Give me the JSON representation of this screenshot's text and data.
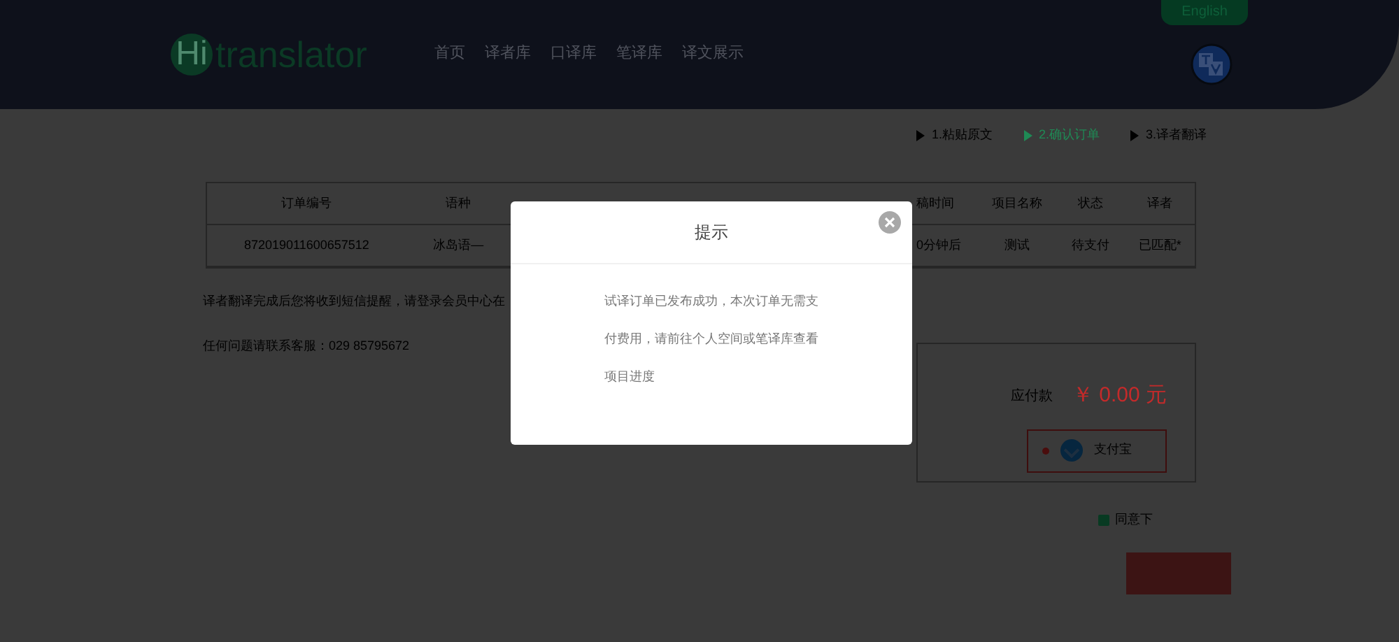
{
  "header": {
    "logo": {
      "mark": "Hi",
      "text": "translator"
    },
    "nav": [
      {
        "label": "首页"
      },
      {
        "label": "译者库"
      },
      {
        "label": "口译库"
      },
      {
        "label": "笔译库"
      },
      {
        "label": "译文展示"
      }
    ],
    "language_button": "English"
  },
  "steps": [
    {
      "label": "1.粘贴原文",
      "selected": false
    },
    {
      "label": "2.确认订单",
      "selected": true
    },
    {
      "label": "3.译者翻译",
      "selected": false
    }
  ],
  "order_table": {
    "columns": [
      "订单编号",
      "语种",
      "稿时间",
      "项目名称",
      "状态",
      "译者"
    ],
    "rows": [
      [
        "872019011600657512",
        "冰岛语—",
        "0分钟后",
        "测试",
        "待支付",
        "已匹配*"
      ]
    ]
  },
  "notices": [
    "译者翻译完成后您将收到短信提醒，请登录会员中心在",
    "任何问题请联系客服：029 85795672"
  ],
  "payment": {
    "label": "应付款",
    "amount": "￥ 0.00 元",
    "methods": [
      {
        "label": "支付宝",
        "selected": true
      }
    ]
  },
  "agreement": {
    "label": "同意下",
    "checked": true
  },
  "dialog": {
    "title": "提示",
    "message": "试译订单已发布成功，本次订单无需支付费用，请前往个人空间或笔译库查看项目进度"
  }
}
